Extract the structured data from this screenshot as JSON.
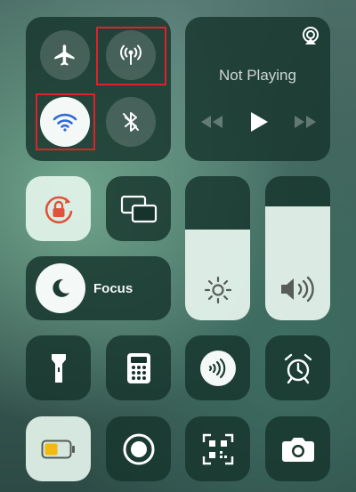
{
  "connectivity": {
    "airplane_mode": {
      "state": "off",
      "icon": "airplane-icon"
    },
    "cellular_data": {
      "state": "on",
      "icon": "antenna-icon",
      "color": "#2f9e5b"
    },
    "wifi": {
      "state": "on",
      "icon": "wifi-icon"
    },
    "bluetooth": {
      "state": "off",
      "icon": "bluetooth-icon"
    }
  },
  "now_playing": {
    "title": "Not Playing",
    "airplay_icon": "airplay-icon",
    "controls": [
      "rewind-icon",
      "play-icon",
      "fast-forward-icon"
    ]
  },
  "toggles": {
    "orientation_lock": {
      "state": "on",
      "icon": "rotation-lock-icon",
      "color": "#e0523b"
    },
    "screen_mirroring": {
      "icon": "screen-mirroring-icon"
    }
  },
  "focus": {
    "label": "Focus",
    "icon": "moon-icon"
  },
  "brightness": {
    "level": 0.63,
    "icon": "sun-icon"
  },
  "volume": {
    "level": 0.79,
    "icon": "speaker-icon"
  },
  "shortcuts": [
    {
      "name": "flashlight",
      "icon": "flashlight-icon"
    },
    {
      "name": "calculator",
      "icon": "calculator-icon"
    },
    {
      "name": "tap-to-pay",
      "icon": "contactless-icon"
    },
    {
      "name": "alarm",
      "icon": "alarm-clock-icon"
    },
    {
      "name": "low-power-mode",
      "icon": "battery-icon",
      "color": "#f2b90f"
    },
    {
      "name": "screen-recording",
      "icon": "record-icon"
    },
    {
      "name": "code-scanner",
      "icon": "qr-code-icon"
    },
    {
      "name": "camera",
      "icon": "camera-icon"
    }
  ]
}
